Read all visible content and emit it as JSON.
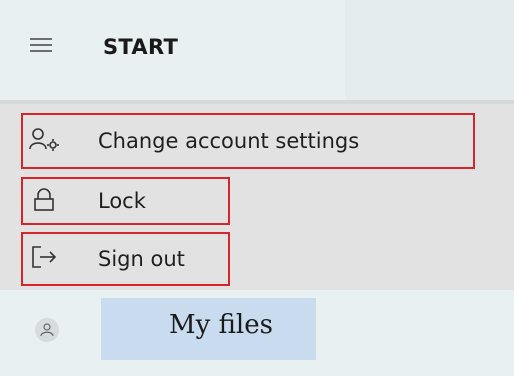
{
  "header": {
    "menu_icon": "hamburger-menu-icon",
    "title": "START"
  },
  "menu": {
    "items": [
      {
        "label": "Change account settings",
        "icon": "account-settings-icon"
      },
      {
        "label": "Lock",
        "icon": "lock-icon"
      },
      {
        "label": "Sign out",
        "icon": "sign-out-icon"
      }
    ]
  },
  "bottom": {
    "avatar_icon": "user-avatar-icon",
    "files_label": "My files"
  },
  "colors": {
    "highlight_border": "#d7262b",
    "header_bg": "#e5eced",
    "menu_bg": "#e2e2e2",
    "files_tile_bg": "#c9dcef"
  }
}
